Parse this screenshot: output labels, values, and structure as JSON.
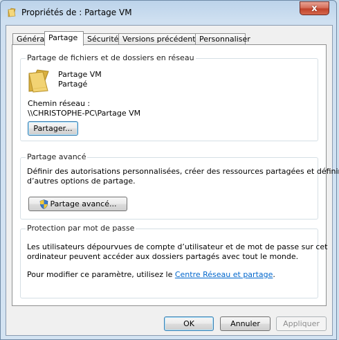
{
  "window": {
    "title": "Propriétés de : Partage VM",
    "close_label": "x"
  },
  "tabs": [
    {
      "label": "Général"
    },
    {
      "label": "Partage"
    },
    {
      "label": "Sécurité"
    },
    {
      "label": "Versions précédentes"
    },
    {
      "label": "Personnaliser"
    }
  ],
  "network_sharing": {
    "title": "Partage de fichiers et de dossiers en réseau",
    "item_name": "Partage VM",
    "item_status": "Partagé",
    "path_label": "Chemin réseau :",
    "path_value": "\\\\CHRISTOPHE-PC\\Partage VM",
    "share_button": "Partager..."
  },
  "advanced_sharing": {
    "title": "Partage avancé",
    "description_line1": "Définir des autorisations personnalisées, créer des ressources partagées et définir",
    "description_line2": "d’autres options de partage.",
    "button": "Partage avancé..."
  },
  "password_protection": {
    "title": "Protection par mot de passe",
    "description_line1": "Les utilisateurs dépourvues de compte d’utilisateur et de mot de passe sur cet",
    "description_line2": "ordinateur peuvent accéder aux dossiers partagés avec tout le monde.",
    "modify_prefix": "Pour modifier ce paramètre, utilisez le ",
    "modify_link": "Centre Réseau et partage",
    "modify_suffix": "."
  },
  "footer": {
    "ok": "OK",
    "cancel": "Annuler",
    "apply": "Appliquer"
  },
  "icons": {
    "title": "folder-icon",
    "item": "folder-icon",
    "advanced": "shield-icon"
  },
  "colors": {
    "link": "#0066cc",
    "close_button": "#c1432b",
    "folder": "#e8c65a"
  }
}
